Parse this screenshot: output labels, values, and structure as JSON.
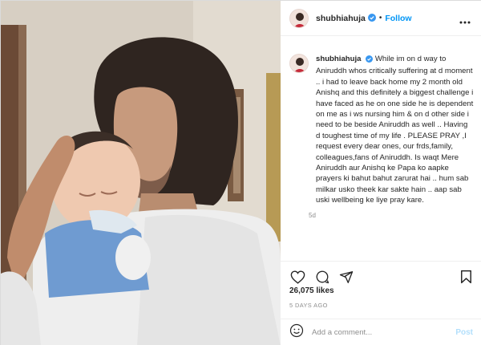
{
  "header": {
    "username": "shubhiahuja",
    "separator": "•",
    "follow_label": "Follow"
  },
  "caption": {
    "username": "shubhiahuja",
    "text": "While im on d way to Aniruddh whos critically suffering at d moment .. i had to leave back home my 2 month old Anishq and this definitely a biggest challenge i have faced as he on one side he is dependent on me as i ws nursing him & on d other side i need to be beside Aniruddh as well .. Having d toughest time of my life . PLEASE PRAY ,I request every dear ones, our frds,family, colleagues,fans of Aniruddh. Is waqt Mere Aniruddh aur Anishq ke Papa ko aapke prayers ki bahut bahut zarurat hai .. hum sab milkar usko theek kar sakte hain .. aap sab uski wellbeing ke liye pray kare.",
    "time": "5d"
  },
  "stats": {
    "likes": "26,075 likes",
    "posted_ago": "5 DAYS AGO"
  },
  "comment_box": {
    "placeholder": "Add a comment...",
    "post_label": "Post"
  },
  "icons": {
    "verified": "verified-badge-icon",
    "more": "more-options-icon",
    "like": "heart-icon",
    "comment": "comment-icon",
    "share": "share-icon",
    "save": "bookmark-icon",
    "emoji": "emoji-icon"
  },
  "colors": {
    "accent": "#0095f6",
    "verified": "#3897f0",
    "muted": "#8e8e8e",
    "post_disabled": "#b2dffc"
  }
}
